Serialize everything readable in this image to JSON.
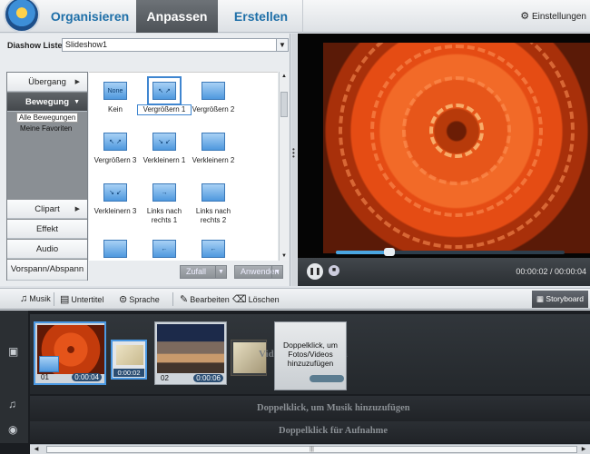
{
  "topbar": {
    "tabs": [
      {
        "label": "Organisieren"
      },
      {
        "label": "Anpassen"
      },
      {
        "label": "Erstellen"
      }
    ],
    "settings_label": "Einstellungen"
  },
  "slideshow": {
    "label": "Diashow Liste",
    "selected": "Slideshow1"
  },
  "categories": [
    {
      "label": "Übergang"
    },
    {
      "label": "Bewegung"
    },
    {
      "label": "Clipart"
    },
    {
      "label": "Effekt"
    },
    {
      "label": "Audio"
    },
    {
      "label": "Vorspann/Abspann"
    }
  ],
  "subcategories": [
    {
      "label": "Alle Bewegungen"
    },
    {
      "label": "Meine Favoriten"
    }
  ],
  "effects": [
    {
      "label": "Kein",
      "icon_text": "None"
    },
    {
      "label": "Vergrößern 1"
    },
    {
      "label": "Vergrößern 2"
    },
    {
      "label": "Vergrößern 3"
    },
    {
      "label": "Verkleinern 1"
    },
    {
      "label": "Verkleinern 2"
    },
    {
      "label": "Verkleinern 3"
    },
    {
      "label": "Links nach rechts 1"
    },
    {
      "label": "Links nach rechts 2"
    }
  ],
  "effect_buttons": {
    "random": "Zufall",
    "apply": "Anwenden"
  },
  "player": {
    "time": "00:00:02 / 00:00:04",
    "progress": 0.23
  },
  "toolbar": {
    "music": "Musik",
    "subtitle": "Untertitel",
    "voice": "Sprache",
    "edit": "Bearbeiten",
    "delete": "Löschen",
    "storyboard": "Storyboard"
  },
  "clips": [
    {
      "number": "01",
      "duration": "0:00:04"
    },
    {
      "number": "02",
      "duration": "0:00:06"
    }
  ],
  "transition1_duration": "0:00:02",
  "placeholder": {
    "card_text": "Doppelklick, um Fotos/Videos hinzuzufügen",
    "hint_visible": "Videos hinzuzufügen"
  },
  "music_hint": "Doppelklick, um Musik hinzuzufügen",
  "record_hint": "Doppelklick für Aufnahme",
  "colors": {
    "accent": "#1e6fa8",
    "selection": "#4a98e2"
  }
}
